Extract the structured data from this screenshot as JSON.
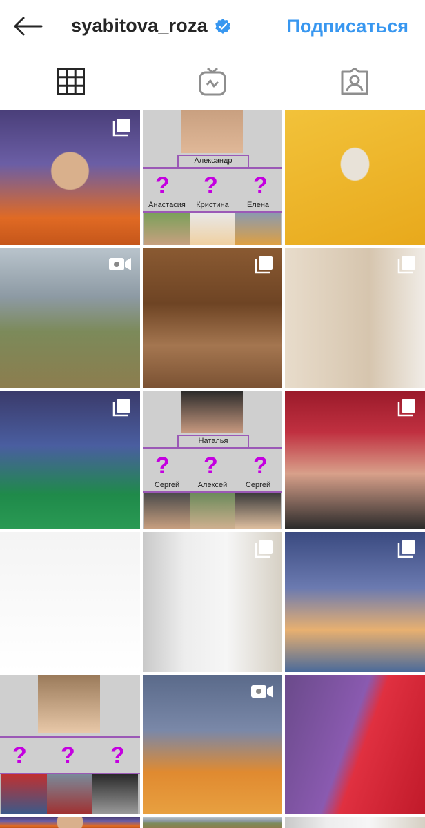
{
  "header": {
    "title": "syabitova_roza",
    "follow_label": "Подписаться",
    "accent_color": "#3897f0"
  },
  "tabs": [
    {
      "icon": "grid-icon"
    },
    {
      "icon": "igtv-icon"
    },
    {
      "icon": "tagged-icon"
    }
  ],
  "collage1": {
    "top_name": "Александр",
    "mark": "?",
    "names": [
      "Анастасия",
      "Кристина",
      "Елена"
    ]
  },
  "collage2": {
    "top_name": "Наталья",
    "mark": "?",
    "names": [
      "Сергей",
      "Алексей",
      "Сергей"
    ]
  },
  "collage3": {
    "mark": "?"
  },
  "badges": {
    "multi": "carousel-icon",
    "video": "video-icon"
  }
}
